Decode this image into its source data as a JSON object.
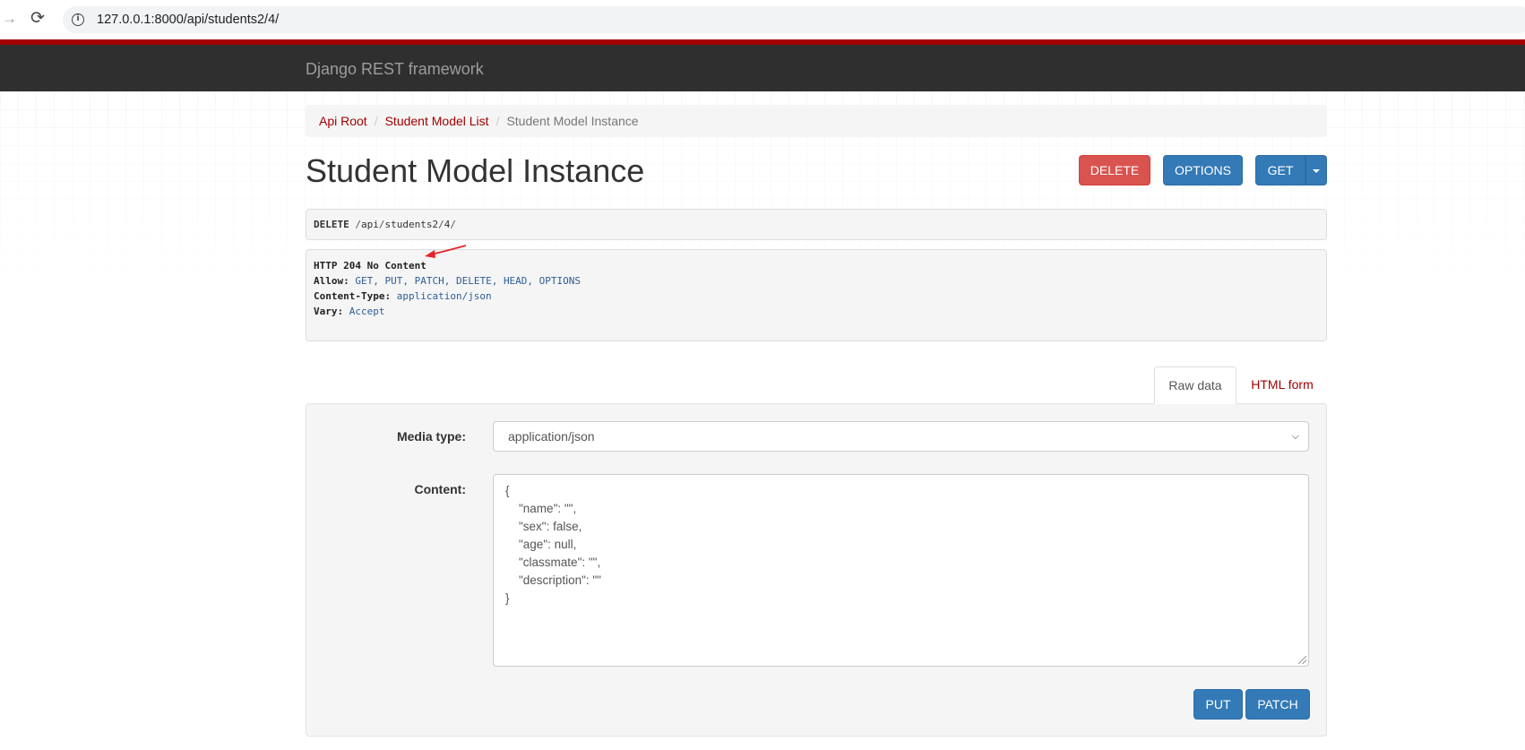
{
  "browser": {
    "url": "127.0.0.1:8000/api/students2/4/"
  },
  "navbar": {
    "brand": "Django REST framework"
  },
  "breadcrumb": {
    "items": [
      "Api Root",
      "Student Model List",
      "Student Model Instance"
    ]
  },
  "page": {
    "title": "Student Model Instance"
  },
  "toolbar": {
    "delete_label": "DELETE",
    "options_label": "OPTIONS",
    "get_label": "GET"
  },
  "request": {
    "method": "DELETE",
    "path_seg1": "api",
    "path_seg2": "students2",
    "path_seg3": "4"
  },
  "response": {
    "status": "HTTP 204 No Content",
    "headers": [
      {
        "key": "Allow:",
        "value": "GET, PUT, PATCH, DELETE, HEAD, OPTIONS"
      },
      {
        "key": "Content-Type:",
        "value": "application/json"
      },
      {
        "key": "Vary:",
        "value": "Accept"
      }
    ]
  },
  "tabs": {
    "raw": "Raw data",
    "html": "HTML form"
  },
  "form": {
    "media_label": "Media type:",
    "media_value": "application/json",
    "content_label": "Content:",
    "content_lines": [
      "{",
      "    \"name\": \"\",",
      "    \"sex\": false,",
      "    \"age\": null,",
      "    \"classmate\": \"\",",
      "    \"description\": \"\"",
      "}"
    ],
    "put_label": "PUT",
    "patch_label": "PATCH"
  },
  "colors": {
    "brand_red": "#a30000",
    "navbar": "#2f2f2f",
    "danger": "#d9534f",
    "primary": "#337ab7",
    "annotation_arrow": "#e3262b"
  }
}
